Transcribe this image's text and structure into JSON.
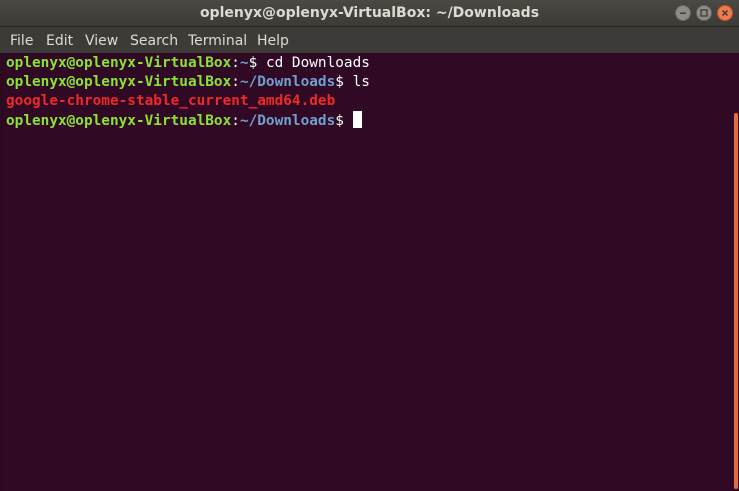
{
  "window": {
    "title": "oplenyx@oplenyx-VirtualBox: ~/Downloads"
  },
  "menubar": {
    "items": [
      "File",
      "Edit",
      "View",
      "Search",
      "Terminal",
      "Help"
    ]
  },
  "terminal": {
    "lines": [
      {
        "user_host": "oplenyx@oplenyx-VirtualBox",
        "colon": ":",
        "path": "~",
        "prompt": "$ ",
        "command": "cd Downloads"
      },
      {
        "user_host": "oplenyx@oplenyx-VirtualBox",
        "colon": ":",
        "path": "~/Downloads",
        "prompt": "$ ",
        "command": "ls"
      },
      {
        "output": "google-chrome-stable_current_amd64.deb"
      },
      {
        "user_host": "oplenyx@oplenyx-VirtualBox",
        "colon": ":",
        "path": "~/Downloads",
        "prompt": "$ ",
        "command": ""
      }
    ]
  },
  "colors": {
    "background": "#300a24",
    "user_host": "#8ae234",
    "path": "#729fcf",
    "file_output": "#ef2929",
    "scrollbar": "#e06e3e",
    "close_button": "#ef7b4c"
  },
  "icons": {
    "minimize": "minimize-icon",
    "maximize": "maximize-icon",
    "close": "close-icon"
  }
}
